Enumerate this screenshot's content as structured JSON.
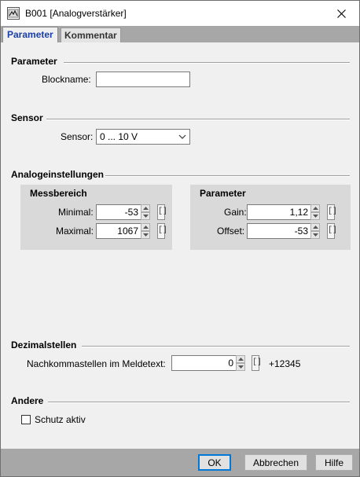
{
  "window": {
    "title": "B001 [Analogverstärker]"
  },
  "tabs": [
    {
      "label": "Parameter"
    },
    {
      "label": "Kommentar"
    }
  ],
  "parameter_section": {
    "title": "Parameter",
    "blockname_label": "Blockname:",
    "blockname_value": ""
  },
  "sensor_section": {
    "title": "Sensor",
    "sensor_label": "Sensor:",
    "sensor_value": "0 ... 10 V"
  },
  "analog_section": {
    "title": "Analogeinstellungen",
    "messbereich": {
      "title": "Messbereich",
      "min_label": "Minimal:",
      "min_value": "-53",
      "max_label": "Maximal:",
      "max_value": "1067"
    },
    "parameter": {
      "title": "Parameter",
      "gain_label": "Gain:",
      "gain_value": "1,12",
      "offset_label": "Offset:",
      "offset_value": "-53"
    }
  },
  "dezimal_section": {
    "title": "Dezimalstellen",
    "nachkomma_label": "Nachkommastellen im Meldetext:",
    "nachkomma_value": "0",
    "preview": "+12345"
  },
  "andere_section": {
    "title": "Andere",
    "schutz_label": "Schutz aktiv",
    "schutz_checked": false
  },
  "buttons": {
    "ok": "OK",
    "cancel": "Abbrechen",
    "help": "Hilfe"
  },
  "link_glyph": "[]",
  "colors": {
    "active_tab_text": "#1a3ea8",
    "frame_gray": "#a7a7a7",
    "group_bg": "#d9d9d9",
    "default_button_border": "#0078d7"
  }
}
